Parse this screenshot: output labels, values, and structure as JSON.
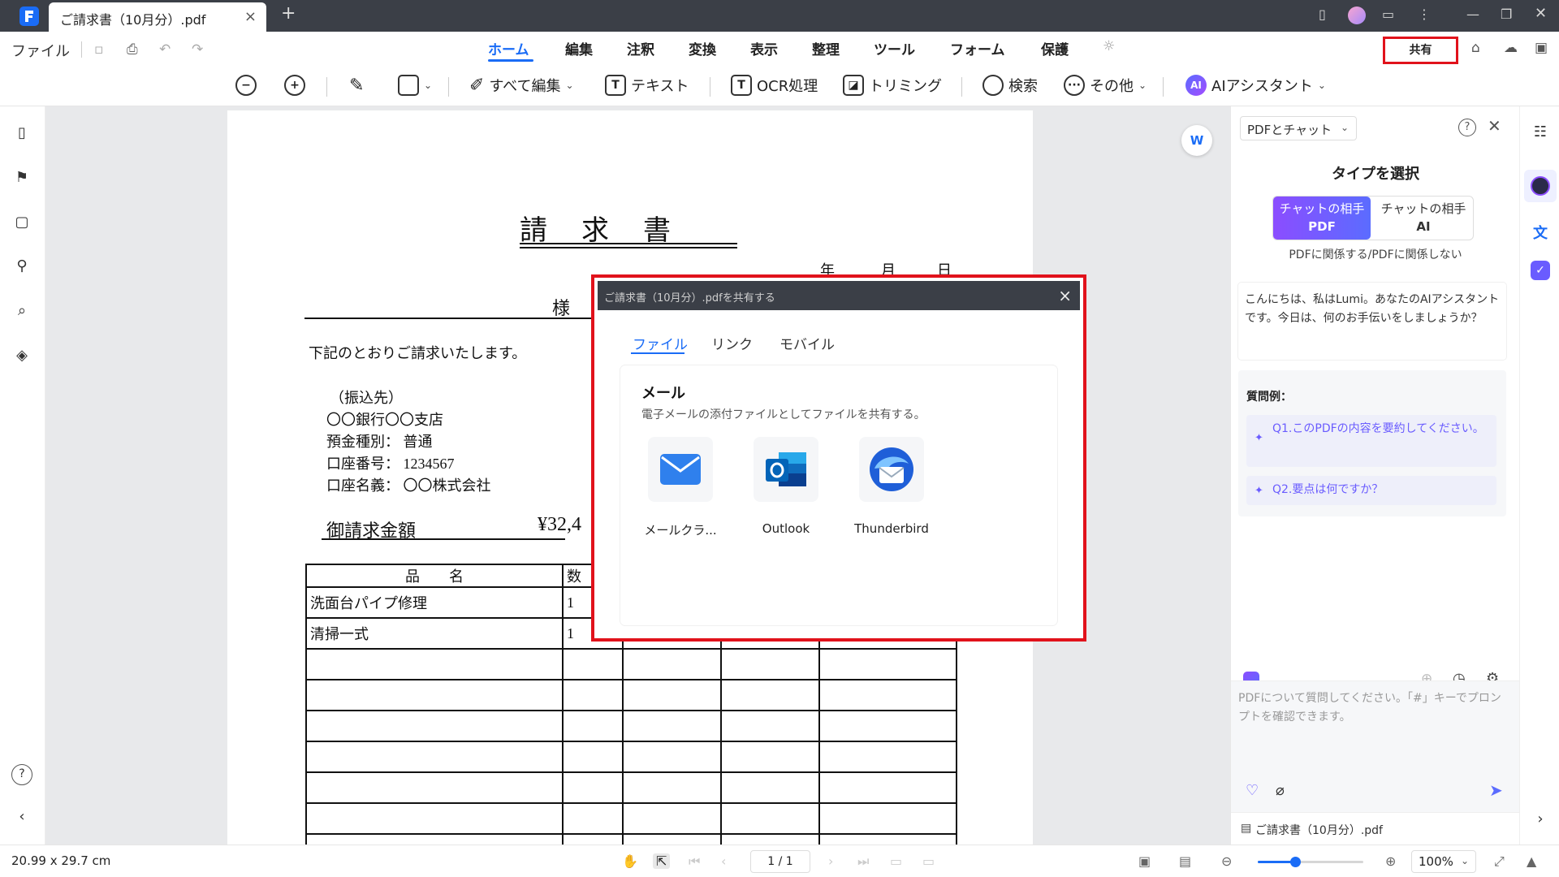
{
  "titlebar": {
    "tab_title": "ご請求書（10月分）.pdf",
    "tab_close": "×",
    "new_tab": "+"
  },
  "menubar": {
    "file": "ファイル",
    "items": [
      "ホーム",
      "編集",
      "注釈",
      "変換",
      "表示",
      "整理",
      "ツール",
      "フォーム",
      "保護"
    ],
    "active": "ホーム",
    "share": "共有"
  },
  "toolbar": {
    "edit_all": "すべて編集",
    "text": "テキスト",
    "ocr": "OCR処理",
    "crop": "トリミング",
    "search": "検索",
    "more": "その他",
    "ai_assistant": "AIアシスタント",
    "ai_badge": "AI"
  },
  "document": {
    "title": "請求書",
    "date_labels": [
      "年",
      "月",
      "日"
    ],
    "addressee_suffix": "様",
    "intro": "下記のとおりご請求いたします。",
    "bank_header": "（振込先）",
    "bank_lines": [
      "〇〇銀行〇〇支店",
      "預金種別：  普通",
      "口座番号：  1234567",
      "口座名義：  〇〇株式会社"
    ],
    "amount_label": "御請求金額",
    "amount_value": "¥32,4",
    "table_header": [
      "品　　名",
      "数"
    ],
    "table_rows": [
      [
        "洗面台パイプ修理",
        "1"
      ],
      [
        "清掃一式",
        "1"
      ]
    ]
  },
  "share_dialog": {
    "title": "ご請求書（10月分）.pdfを共有する",
    "close": "×",
    "tabs": [
      "ファイル",
      "リンク",
      "モバイル"
    ],
    "active_tab": "ファイル",
    "section_title": "メール",
    "section_desc": "電子メールの添付ファイルとしてファイルを共有する。",
    "apps": [
      "メールクラ...",
      "Outlook",
      "Thunderbird"
    ]
  },
  "ai_panel": {
    "mode_select": "PDFとチャット",
    "type_title": "タイプを選択",
    "option_pdf": {
      "line1": "チャットの相手",
      "line2": "PDF"
    },
    "option_ai": {
      "line1": "チャットの相手",
      "line2": "AI"
    },
    "type_desc": "PDFに関係する/PDFに関係しない",
    "greeting": "こんにちは、私はLumi。あなたのAIアシスタントです。今日は、何のお手伝いをしましょうか？",
    "examples_label": "質問例：",
    "examples": [
      "Q1.このPDFの内容を要約してください。",
      "Q2.要点は何ですか？"
    ],
    "input_placeholder": "PDFについて質問してください。「#」キーでプロンプトを確認できます。",
    "file_name": "ご請求書（10月分）.pdf"
  },
  "statusbar": {
    "page_size": "20.99 x 29.7 cm",
    "page_indicator": "1 / 1",
    "zoom": "100%",
    "zoom_level": 0.35
  },
  "colors": {
    "accent": "#1a6cf6",
    "highlight_red": "#e1121b",
    "titlebar": "#3b3f47",
    "ai_purple": "#8b4dff"
  }
}
